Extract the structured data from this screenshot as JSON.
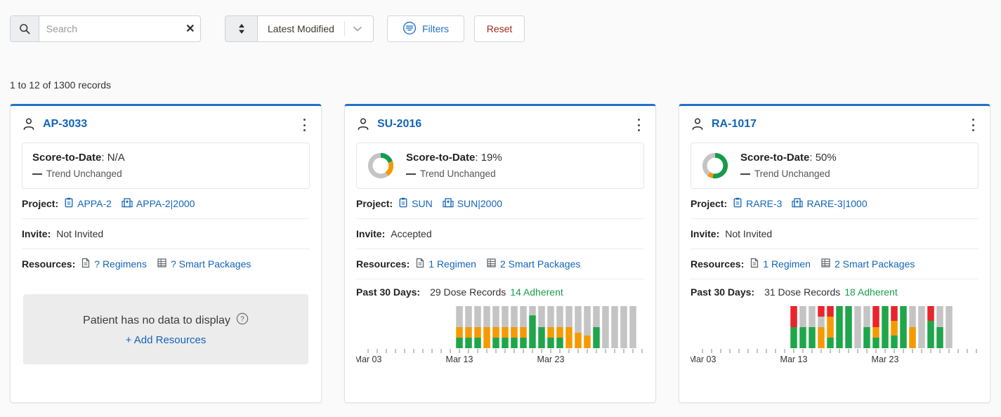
{
  "toolbar": {
    "search": {
      "value": "",
      "placeholder": "Search",
      "clear_label": "✕",
      "icon": "search-icon"
    },
    "sort": {
      "value": "Latest Modified",
      "icon": "sort-updown-icon",
      "caret": "chevron-down-icon"
    },
    "filters_label": "Filters",
    "reset_label": "Reset",
    "colors": {
      "link": "#1465b7",
      "filters": "#2272c4",
      "reset": "#a52a1f",
      "accent_top": "#2272c4"
    }
  },
  "records_text": "1 to 12 of 1300 records",
  "cards": [
    {
      "title": "AP-3033",
      "score_label": "Score-to-Date",
      "score_value": "N/A",
      "has_donut": false,
      "trend_text": "Trend Unchanged",
      "project_label": "Project:",
      "project_study": "APPA-2",
      "project_site": "APPA-2|2000",
      "invite_label": "Invite:",
      "invite_value": "Not Invited",
      "resources_label": "Resources:",
      "resource_regimens": "? Regimens",
      "resource_packages": "? Smart Packages",
      "empty_title": "Patient has no data to display",
      "empty_link": "+ Add Resources",
      "empty_help_icon": "question-circle-icon"
    },
    {
      "title": "SU-2016",
      "score_label": "Score-to-Date",
      "score_value": "19%",
      "has_donut": true,
      "donut": {
        "green_pct": 19,
        "orange_pct": 21,
        "gray_pct": 60
      },
      "trend_text": "Trend Unchanged",
      "project_label": "Project:",
      "project_study": "SUN",
      "project_site": "SUN|2000",
      "invite_label": "Invite:",
      "invite_value": "Accepted",
      "resources_label": "Resources:",
      "resource_regimens": "1 Regimen",
      "resource_packages": "2 Smart Packages",
      "past_label": "Past 30 Days:",
      "past_doses": "29 Dose Records",
      "past_adherent": "14 Adherent"
    },
    {
      "title": "RA-1017",
      "score_label": "Score-to-Date",
      "score_value": "50%",
      "has_donut": true,
      "donut": {
        "green_pct": 53,
        "orange_pct": 7,
        "gray_pct": 40
      },
      "trend_text": "Trend Unchanged",
      "project_label": "Project:",
      "project_study": "RARE-3",
      "project_site": "RARE-3|1000",
      "invite_label": "Invite:",
      "invite_value": "Not Invited",
      "resources_label": "Resources:",
      "resource_regimens": "1 Regimen",
      "resource_packages": "2 Smart Packages",
      "past_label": "Past 30 Days:",
      "past_doses": "31 Dose Records",
      "past_adherent": "18 Adherent"
    }
  ],
  "chart_data": [
    {
      "id": "su-2016-adherence",
      "type": "bar",
      "title": "Past 30 Days",
      "stacked": true,
      "xlabel": "",
      "ylabel": "",
      "ylim": [
        0,
        1
      ],
      "grid": false,
      "legend": false,
      "tick_labels": [
        "Mar 03",
        "Mar 13",
        "Mar 23"
      ],
      "tick_label_index": [
        0,
        10,
        20
      ],
      "n_days": 30,
      "colors": {
        "adherent": "#1fa64a",
        "partial": "#f59a00",
        "missed": "#e8252b",
        "none": "#c4c4c4"
      },
      "days": [
        {
          "none": 0,
          "partial": 0,
          "adherent": 0
        },
        {
          "none": 0,
          "partial": 0,
          "adherent": 0
        },
        {
          "none": 0,
          "partial": 0,
          "adherent": 0
        },
        {
          "none": 0,
          "partial": 0,
          "adherent": 0
        },
        {
          "none": 0,
          "partial": 0,
          "adherent": 0
        },
        {
          "none": 0,
          "partial": 0,
          "adherent": 0
        },
        {
          "none": 0,
          "partial": 0,
          "adherent": 0
        },
        {
          "none": 0,
          "partial": 0,
          "adherent": 0
        },
        {
          "none": 0,
          "partial": 0,
          "adherent": 0
        },
        {
          "none": 0,
          "partial": 0,
          "adherent": 0
        },
        {
          "none": 0.5,
          "partial": 0.25,
          "adherent": 0.25
        },
        {
          "none": 0.5,
          "partial": 0.25,
          "adherent": 0.25
        },
        {
          "none": 0.5,
          "partial": 0.25,
          "adherent": 0.25
        },
        {
          "none": 0.5,
          "partial": 0.5,
          "adherent": 0.0
        },
        {
          "none": 0.5,
          "partial": 0.25,
          "adherent": 0.25
        },
        {
          "none": 0.5,
          "partial": 0.25,
          "adherent": 0.25
        },
        {
          "none": 0.5,
          "partial": 0.25,
          "adherent": 0.25
        },
        {
          "none": 0.5,
          "partial": 0.25,
          "adherent": 0.25
        },
        {
          "none": 0.22,
          "partial": 0.0,
          "adherent": 0.78
        },
        {
          "none": 0.5,
          "partial": 0.0,
          "adherent": 0.5
        },
        {
          "none": 0.5,
          "partial": 0.25,
          "adherent": 0.25
        },
        {
          "none": 0.5,
          "partial": 0.25,
          "adherent": 0.25
        },
        {
          "none": 0.5,
          "partial": 0.5,
          "adherent": 0.0
        },
        {
          "none": 0.63,
          "partial": 0.37,
          "adherent": 0.0
        },
        {
          "none": 0.7,
          "partial": 0.3,
          "adherent": 0.0
        },
        {
          "none": 0.5,
          "partial": 0.0,
          "adherent": 0.5
        },
        {
          "none": 1.0,
          "partial": 0.0,
          "adherent": 0.0
        },
        {
          "none": 1.0,
          "partial": 0.0,
          "adherent": 0.0
        },
        {
          "none": 1.0,
          "partial": 0.0,
          "adherent": 0.0
        },
        {
          "none": 1.0,
          "partial": 0.0,
          "adherent": 0.0
        }
      ]
    },
    {
      "id": "ra-1017-adherence",
      "type": "bar",
      "title": "Past 30 Days",
      "stacked": true,
      "xlabel": "",
      "ylabel": "",
      "ylim": [
        0,
        1
      ],
      "grid": false,
      "legend": false,
      "tick_labels": [
        "Mar 03",
        "Mar 13",
        "Mar 23"
      ],
      "tick_label_index": [
        0,
        10,
        20
      ],
      "n_days": 30,
      "colors": {
        "adherent": "#1fa64a",
        "partial": "#f59a00",
        "missed": "#e8252b",
        "none": "#c4c4c4"
      },
      "days": [
        {
          "missed": 0,
          "none": 0,
          "partial": 0,
          "adherent": 0
        },
        {
          "missed": 0,
          "none": 0,
          "partial": 0,
          "adherent": 0
        },
        {
          "missed": 0,
          "none": 0,
          "partial": 0,
          "adherent": 0
        },
        {
          "missed": 0,
          "none": 0,
          "partial": 0,
          "adherent": 0
        },
        {
          "missed": 0,
          "none": 0,
          "partial": 0,
          "adherent": 0
        },
        {
          "missed": 0,
          "none": 0,
          "partial": 0,
          "adherent": 0
        },
        {
          "missed": 0,
          "none": 0,
          "partial": 0,
          "adherent": 0
        },
        {
          "missed": 0,
          "none": 0,
          "partial": 0,
          "adherent": 0
        },
        {
          "missed": 0,
          "none": 0,
          "partial": 0,
          "adherent": 0
        },
        {
          "missed": 0,
          "none": 0,
          "partial": 0,
          "adherent": 0
        },
        {
          "missed": 0.5,
          "none": 0.0,
          "partial": 0.0,
          "adherent": 0.5
        },
        {
          "missed": 0.0,
          "none": 0.5,
          "partial": 0.0,
          "adherent": 0.5
        },
        {
          "missed": 0.0,
          "none": 0.5,
          "partial": 0.0,
          "adherent": 0.5
        },
        {
          "missed": 0.25,
          "none": 0.25,
          "partial": 0.5,
          "adherent": 0.0
        },
        {
          "missed": 0.25,
          "none": 0.0,
          "partial": 0.5,
          "adherent": 0.25
        },
        {
          "missed": 0.0,
          "none": 0.0,
          "partial": 0.0,
          "adherent": 1.0
        },
        {
          "missed": 0.0,
          "none": 0.0,
          "partial": 0.0,
          "adherent": 1.0
        },
        {
          "missed": 0.0,
          "none": 1.0,
          "partial": 0.0,
          "adherent": 0.0
        },
        {
          "missed": 0.0,
          "none": 0.5,
          "partial": 0.0,
          "adherent": 0.5
        },
        {
          "missed": 0.5,
          "none": 0.0,
          "partial": 0.25,
          "adherent": 0.25
        },
        {
          "missed": 0.0,
          "none": 0.0,
          "partial": 0.0,
          "adherent": 1.0
        },
        {
          "missed": 0.35,
          "none": 0.0,
          "partial": 0.35,
          "adherent": 0.3
        },
        {
          "missed": 0.0,
          "none": 0.0,
          "partial": 0.0,
          "adherent": 1.0
        },
        {
          "missed": 0.0,
          "none": 0.5,
          "partial": 0.5,
          "adherent": 0.0
        },
        {
          "missed": 0.0,
          "none": 1.0,
          "partial": 0.0,
          "adherent": 0.0
        },
        {
          "missed": 0.35,
          "none": 0.0,
          "partial": 0.0,
          "adherent": 0.65
        },
        {
          "missed": 0.0,
          "none": 0.5,
          "partial": 0.0,
          "adherent": 0.5
        },
        {
          "missed": 0.0,
          "none": 1.0,
          "partial": 0.0,
          "adherent": 0.0
        },
        {
          "missed": 0.0,
          "none": 0.0,
          "partial": 0.0,
          "adherent": 0.0
        },
        {
          "missed": 0.0,
          "none": 0.0,
          "partial": 0.0,
          "adherent": 0.0
        }
      ]
    }
  ]
}
